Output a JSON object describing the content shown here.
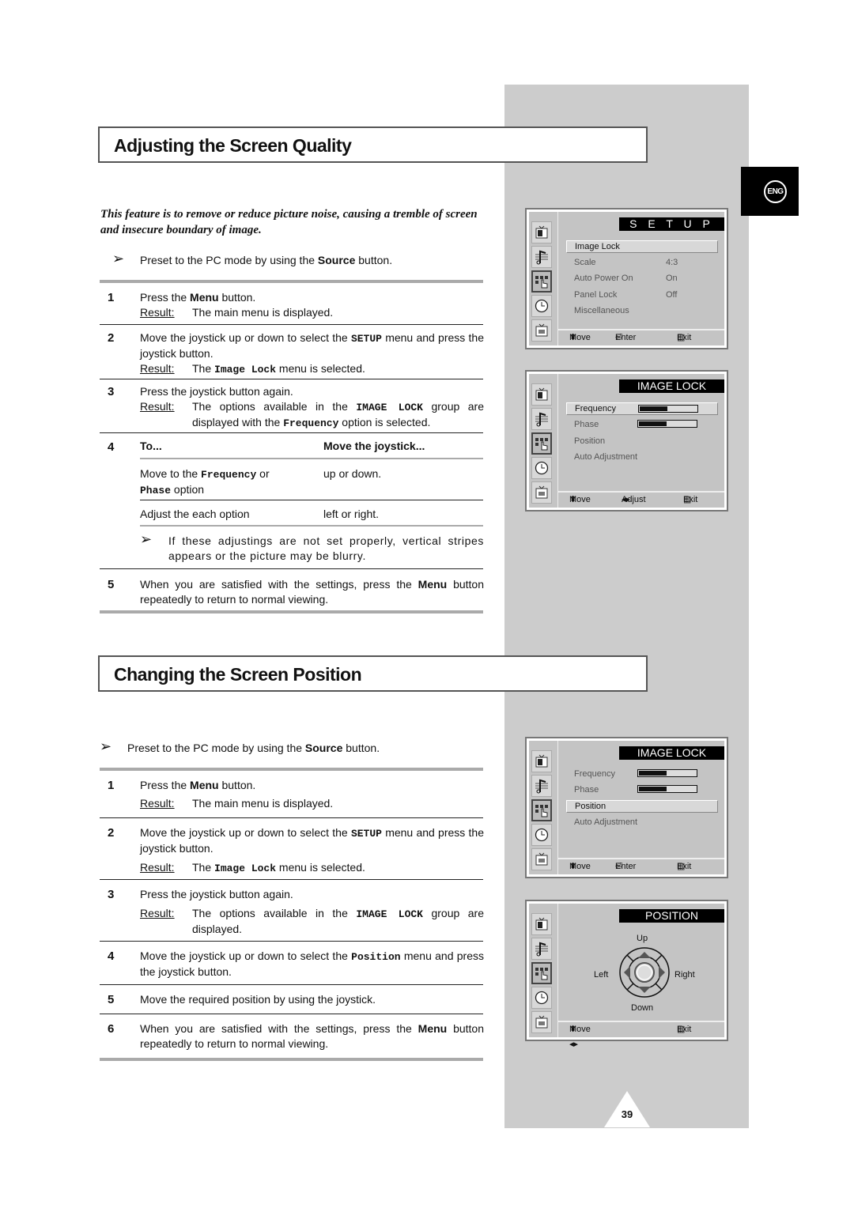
{
  "lang_tab": "ENG",
  "page_number": "39",
  "section1": {
    "title": "Adjusting the Screen Quality",
    "intro": "This feature is to remove or reduce picture noise, causing a tremble of screen and insecure boundary of image.",
    "note_pre": "Preset to the PC mode by using the ",
    "note_bold": "Source",
    "note_post": " button.",
    "steps": [
      {
        "num": "1",
        "t1": "Press the ",
        "b1": "Menu",
        "t2": " button.",
        "result_label": "Result:",
        "result": "The main menu is displayed."
      },
      {
        "num": "2",
        "t1": "Move the joystick up or down to select the ",
        "m1": "SETUP",
        "t2": " menu and press the joystick button.",
        "result_label": "Result:",
        "r1": "The ",
        "rm": "Image Lock",
        "r2": " menu is selected."
      },
      {
        "num": "3",
        "t1": "Press the joystick button again.",
        "result_label": "Result:",
        "r1": "The options available in the ",
        "rm": "IMAGE LOCK",
        "r2": " group are displayed with the ",
        "rm2": "Frequency",
        "r3": " option is selected."
      },
      {
        "num": "4",
        "col1_header": "To...",
        "col2_header": "Move the joystick...",
        "rows": [
          {
            "a1": "Move to the ",
            "am1": "Frequency",
            "a2": " or ",
            "am2": "Phase",
            "a3": " option",
            "b": "up or down."
          },
          {
            "a1": "Adjust the each option",
            "b": "left or right."
          }
        ],
        "note": "If these adjustings are not set properly, vertical stripes appears or the picture may be blurry."
      },
      {
        "num": "5",
        "t1": "When you are satisfied with the settings, press the ",
        "b1": "Menu",
        "t2": " button repeatedly to return to normal viewing."
      }
    ]
  },
  "section2": {
    "title": "Changing the Screen Position",
    "note_pre": "Preset to the PC mode by using the ",
    "note_bold": "Source",
    "note_post": " button.",
    "steps": [
      {
        "num": "1",
        "t1": "Press the ",
        "b1": "Menu",
        "t2": " button.",
        "result_label": "Result:",
        "result": "The main menu is displayed."
      },
      {
        "num": "2",
        "t1": "Move the joystick up or down to select the ",
        "m1": "SETUP",
        "t2": " menu and press the joystick button.",
        "result_label": "Result:",
        "r1": "The ",
        "rm": "Image Lock",
        "r2": " menu is selected."
      },
      {
        "num": "3",
        "t1": "Press the joystick button again.",
        "result_label": "Result:",
        "r1": "The options available in the ",
        "rm": "IMAGE LOCK",
        "r2": " group are displayed."
      },
      {
        "num": "4",
        "t1": "Move the joystick up or down to select the ",
        "m1": "Position",
        "t2": " menu and press the joystick button."
      },
      {
        "num": "5",
        "t1": "Move the required position by using the joystick."
      },
      {
        "num": "6",
        "t1": "When you are satisfied with the settings, press the ",
        "b1": "Menu",
        "t2": " button repeatedly to return to normal viewing."
      }
    ]
  },
  "osd": {
    "setup": {
      "title": "S E T U P",
      "items": [
        {
          "label": "Image Lock",
          "value": "",
          "selected": true
        },
        {
          "label": "Scale",
          "value": "4:3"
        },
        {
          "label": "Auto Power On",
          "value": "On"
        },
        {
          "label": "Panel Lock",
          "value": "Off"
        },
        {
          "label": "Miscellaneous",
          "value": ""
        }
      ],
      "footer": {
        "move": "Move",
        "enter": "Enter",
        "exit": "Exit"
      }
    },
    "image_lock_1": {
      "title": "IMAGE LOCK",
      "items": [
        {
          "label": "Frequency",
          "level": 0.5,
          "selected": true
        },
        {
          "label": "Phase",
          "level": 0.5
        },
        {
          "label": "Position"
        },
        {
          "label": "Auto Adjustment"
        }
      ],
      "footer": {
        "move": "Move",
        "adjust": "Adjust",
        "exit": "Exit"
      }
    },
    "image_lock_2": {
      "title": "IMAGE LOCK",
      "items": [
        {
          "label": "Frequency",
          "level": 0.5
        },
        {
          "label": "Phase",
          "level": 0.5
        },
        {
          "label": "Position",
          "selected": true
        },
        {
          "label": "Auto Adjustment"
        }
      ],
      "footer": {
        "move": "Move",
        "enter": "Enter",
        "exit": "Exit"
      }
    },
    "position": {
      "title": "POSITION",
      "up": "Up",
      "down": "Down",
      "left": "Left",
      "right": "Right",
      "footer": {
        "move": "Move",
        "exit": "Exit"
      }
    }
  }
}
